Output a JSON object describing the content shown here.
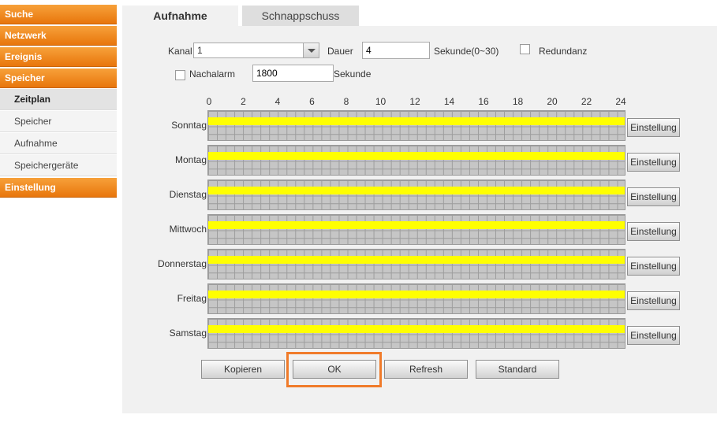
{
  "sidebar": {
    "categories": {
      "suche": "Suche",
      "netzwerk": "Netzwerk",
      "ereignis": "Ereignis",
      "speicher": "Speicher",
      "einstellung": "Einstellung"
    },
    "sub_items": [
      "Zeitplan",
      "Speicher",
      "Aufnahme",
      "Speichergeräte"
    ],
    "active_item": "Zeitplan"
  },
  "tabs": {
    "active": "Aufnahme",
    "inactive": "Schnappschuss"
  },
  "form": {
    "kanal_label": "Kanal",
    "kanal_value": "1",
    "dauer_label": "Dauer",
    "dauer_value": "4",
    "dauer_unit": "Sekunde(0~30)",
    "redundanz_label": "Redundanz",
    "redundanz_checked": false,
    "nachalarm_label": "Nachalarm",
    "nachalarm_checked": false,
    "nachalarm_value": "1800",
    "nachalarm_unit": "Sekunde"
  },
  "schedule": {
    "hours": [
      "0",
      "2",
      "4",
      "6",
      "8",
      "10",
      "12",
      "14",
      "16",
      "18",
      "20",
      "22",
      "24"
    ],
    "days": [
      "Sonntag",
      "Montag",
      "Dienstag",
      "Mittwoch",
      "Donnerstag",
      "Freitag",
      "Samstag"
    ],
    "setting_label": "Einstellung",
    "bar_color": "#ffff00"
  },
  "buttons": {
    "copy": "Kopieren",
    "ok": "OK",
    "refresh": "Refresh",
    "standard": "Standard"
  },
  "colors": {
    "accent": "#ef8a1c",
    "highlight": "#f07b2a"
  }
}
